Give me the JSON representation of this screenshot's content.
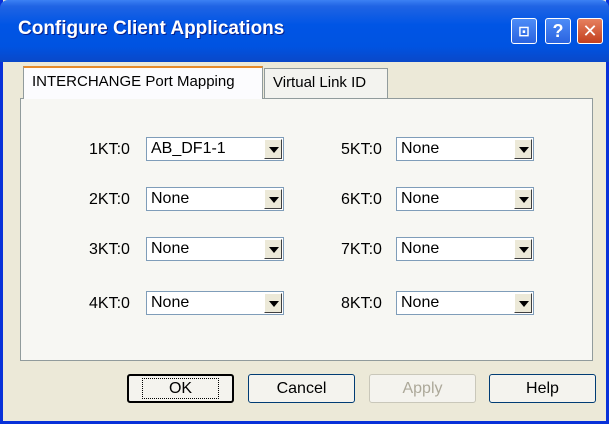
{
  "window": {
    "title": "Configure Client Applications",
    "buttons": {
      "extra": "⊡",
      "help": "?",
      "close": "✕"
    }
  },
  "tabs": [
    {
      "label": "INTERCHANGE Port Mapping",
      "active": true
    },
    {
      "label": "Virtual Link ID",
      "active": false
    }
  ],
  "mappings": [
    {
      "label": "1KT:0",
      "value": "AB_DF1-1"
    },
    {
      "label": "2KT:0",
      "value": "None"
    },
    {
      "label": "3KT:0",
      "value": "None"
    },
    {
      "label": "4KT:0",
      "value": "None"
    },
    {
      "label": "5KT:0",
      "value": "None"
    },
    {
      "label": "6KT:0",
      "value": "None"
    },
    {
      "label": "7KT:0",
      "value": "None"
    },
    {
      "label": "8KT:0",
      "value": "None"
    }
  ],
  "footer": {
    "ok": "OK",
    "cancel": "Cancel",
    "apply": "Apply",
    "help": "Help"
  }
}
